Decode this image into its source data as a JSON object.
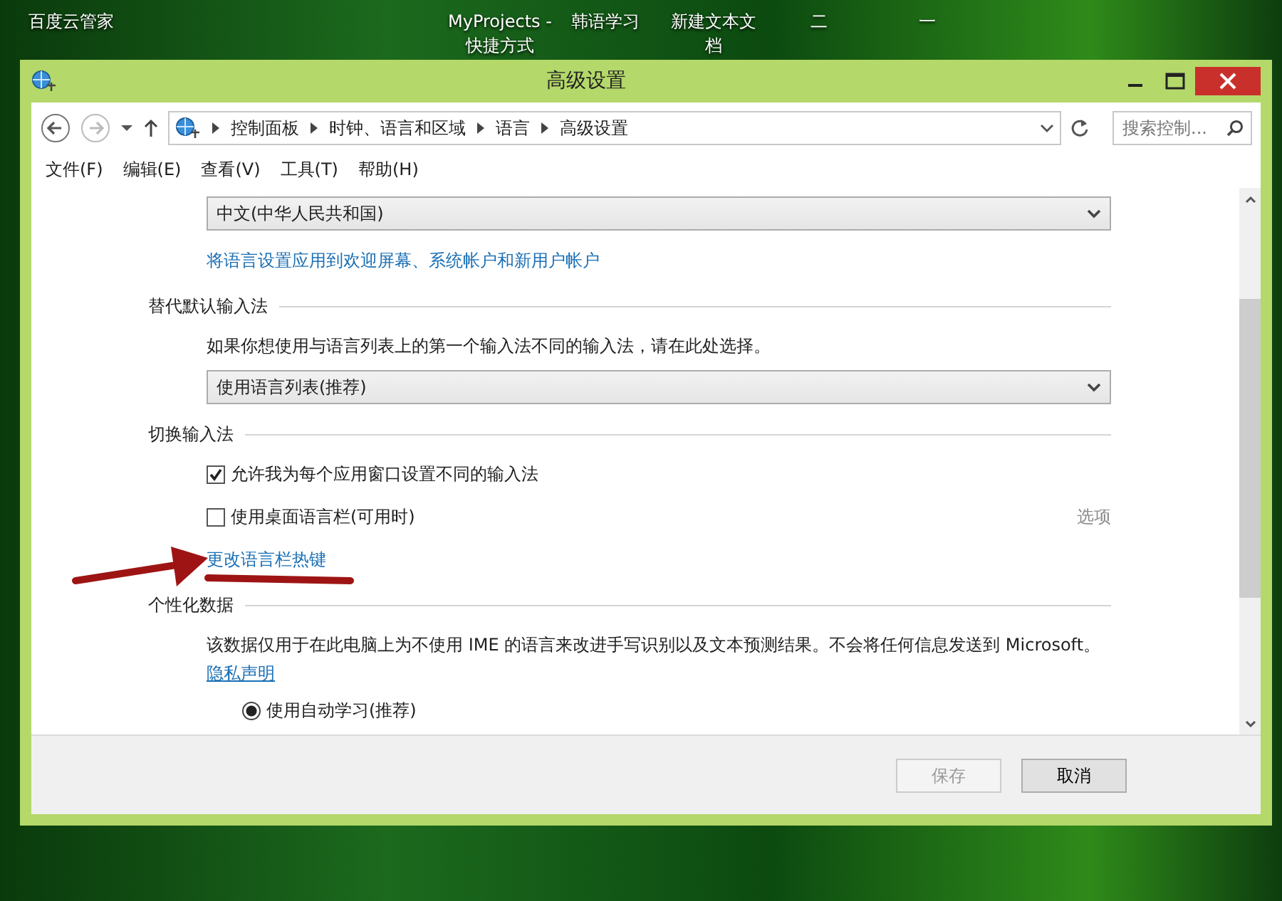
{
  "desktop_icons": [
    {
      "label": "百度云管家"
    },
    {
      "label": "MyProjects - 快捷方式"
    },
    {
      "label": "韩语学习"
    },
    {
      "label": "新建文本文档"
    },
    {
      "label": "二"
    },
    {
      "label": "一"
    }
  ],
  "window": {
    "title": "高级设置"
  },
  "address_bar": {
    "breadcrumbs": [
      "控制面板",
      "时钟、语言和区域",
      "语言",
      "高级设置"
    ]
  },
  "search": {
    "placeholder": "搜索控制..."
  },
  "menu": [
    "文件(F)",
    "编辑(E)",
    "查看(V)",
    "工具(T)",
    "帮助(H)"
  ],
  "content": [
    {
      "kind": "select",
      "value": "中文(中华人民共和国)"
    },
    {
      "kind": "link",
      "text": "将语言设置应用到欢迎屏幕、系统帐户和新用户帐户"
    },
    {
      "kind": "heading",
      "text": "替代默认输入法"
    },
    {
      "kind": "text",
      "text": "如果你想使用与语言列表上的第一个输入法不同的输入法，请在此处选择。"
    },
    {
      "kind": "select",
      "value": "使用语言列表(推荐)"
    },
    {
      "kind": "heading",
      "text": "切换输入法"
    },
    {
      "kind": "checkbox",
      "text": "允许我为每个应用窗口设置不同的输入法",
      "checked": true
    },
    {
      "kind": "checkbox",
      "text": "使用桌面语言栏(可用时)",
      "checked": false,
      "option": {
        "text": "选项",
        "disabled": true
      }
    },
    {
      "kind": "link",
      "text": "更改语言栏热键"
    },
    {
      "kind": "heading",
      "text": "个性化数据"
    },
    {
      "kind": "text",
      "text": "该数据仅用于在此电脑上为不使用 IME 的语言来改进手写识别以及文本预测结果。不会将任何信息发送到 Microsoft。"
    },
    {
      "kind": "underlined_link",
      "text": "隐私声明"
    },
    {
      "kind": "radio",
      "text": "使用自动学习(推荐)",
      "selected": true
    }
  ],
  "buttons": [
    {
      "label": "保存",
      "disabled": true
    },
    {
      "label": "取消",
      "disabled": false
    }
  ]
}
